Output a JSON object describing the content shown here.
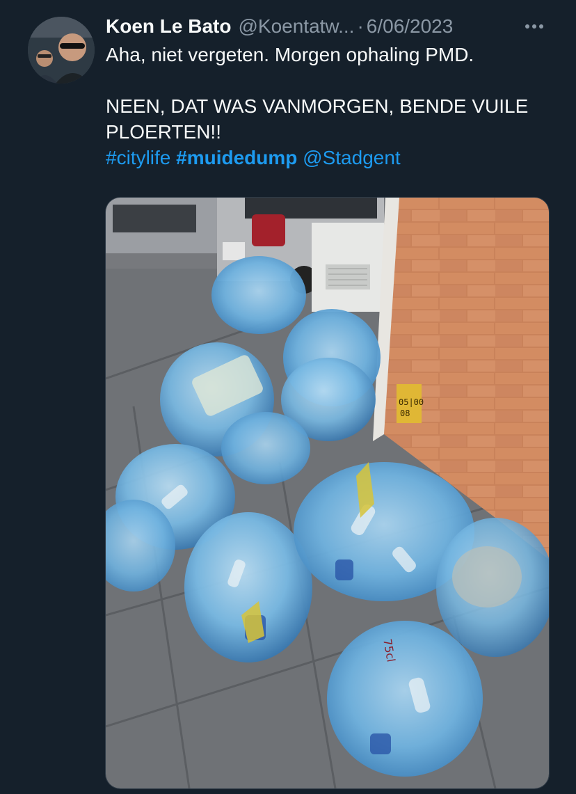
{
  "tweet": {
    "display_name": "Koen Le Bato",
    "handle": "@Koentatw...",
    "separator": "·",
    "date": "6/06/2023",
    "more_icon": "more-horizontal-icon",
    "text_line1": "Aha, niet vergeten. Morgen ophaling PMD.",
    "text_line2": "NEEN, DAT WAS VANMORGEN, BENDE VUILE PLOERTEN!!",
    "hashtag1": "#citylife",
    "hashtag2": "#muidedump",
    "mention": "@Stadgent",
    "photo_sign_text": "05|00 08",
    "bottle_label": "75cl"
  },
  "colors": {
    "background": "#15202b",
    "text": "#f7f9f9",
    "secondary": "#8b98a5",
    "link": "#1d9bf0"
  }
}
